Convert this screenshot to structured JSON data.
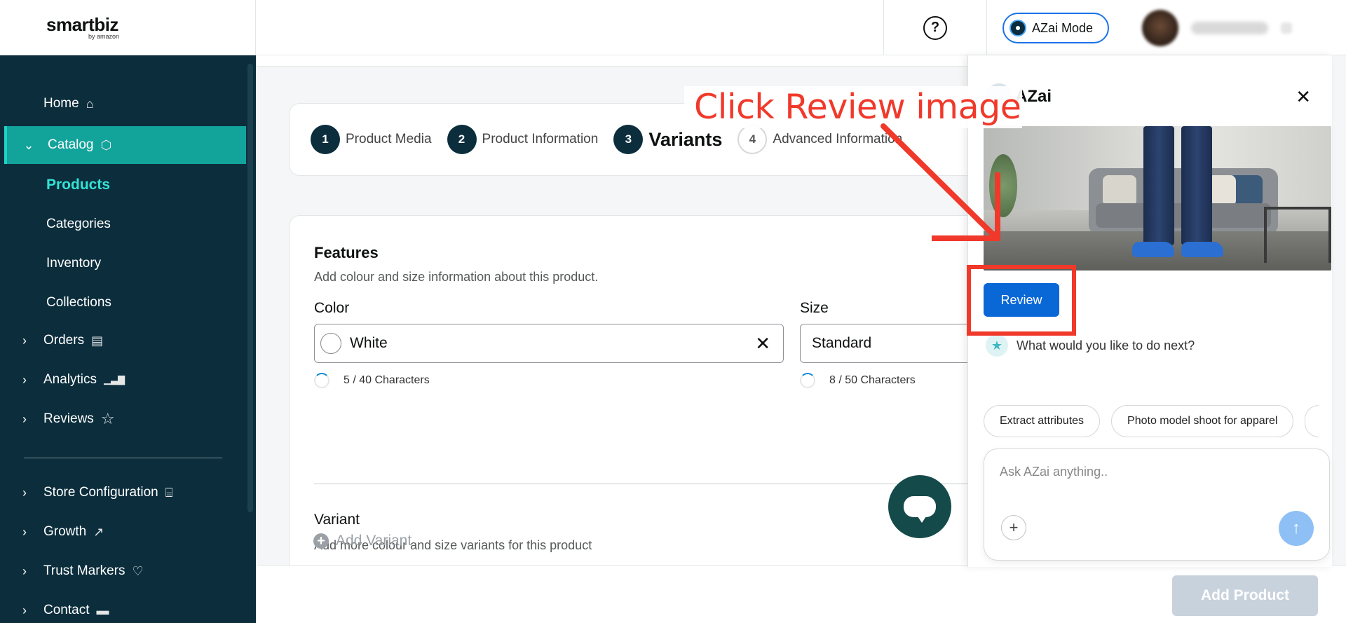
{
  "header": {
    "logo_main": "smartbiz",
    "logo_sub": "by amazon",
    "help_icon": "question-circle-icon",
    "azai_mode_label": "AZai Mode"
  },
  "sidebar": {
    "items": [
      {
        "label": "Home",
        "icon": "home-icon",
        "glyph": "⌂"
      },
      {
        "label": "Catalog",
        "icon": "box-icon",
        "glyph": "⬡"
      },
      {
        "label": "Orders",
        "icon": "clipboard-icon",
        "glyph": "▤"
      },
      {
        "label": "Analytics",
        "icon": "bar-chart-icon",
        "glyph": "▁▃▇"
      },
      {
        "label": "Reviews",
        "icon": "star-icon",
        "glyph": "☆"
      },
      {
        "label": "Store Configuration",
        "icon": "store-icon",
        "glyph": "⌸"
      },
      {
        "label": "Growth",
        "icon": "trend-up-icon",
        "glyph": "↗"
      },
      {
        "label": "Trust Markers",
        "icon": "badge-heart-icon",
        "glyph": "♡"
      },
      {
        "label": "Contact",
        "icon": "chat-bubble-icon",
        "glyph": "▬"
      }
    ],
    "catalog_sub": [
      "Products",
      "Categories",
      "Inventory",
      "Collections"
    ],
    "active_sub": "Products"
  },
  "stepper": {
    "steps": [
      {
        "num": "1",
        "label": "Product Media"
      },
      {
        "num": "2",
        "label": "Product Information"
      },
      {
        "num": "3",
        "label": "Variants"
      },
      {
        "num": "4",
        "label": "Advanced Information"
      }
    ],
    "current": 3
  },
  "features": {
    "title": "Features",
    "desc": "Add colour and size information about this product.",
    "color_label": "Color",
    "color_value": "White",
    "color_count": "5 / 40 Characters",
    "size_label": "Size",
    "size_value": "Standard",
    "size_count": "8 / 50 Characters"
  },
  "variant": {
    "title": "Variant",
    "desc": "Add more colour and size variants for this product",
    "add_label": "Add Variant"
  },
  "footer": {
    "add_product_label": "Add Product"
  },
  "azai_panel": {
    "title": "AZai",
    "close_glyph": "✕",
    "review_label": "Review",
    "next_question": "What would you like to do next?",
    "chips": [
      "Extract attributes",
      "Photo model shoot for apparel"
    ],
    "ask_placeholder": "Ask AZai anything..",
    "plus_glyph": "+",
    "send_glyph": "↑"
  },
  "annotation": {
    "text": "Click Review image",
    "color": "#f0392b"
  },
  "colors": {
    "sidebar_bg": "#0b2d3c",
    "active_bg": "#12a39b",
    "active_sub": "#33e3d6",
    "primary": "#0a67d6"
  }
}
